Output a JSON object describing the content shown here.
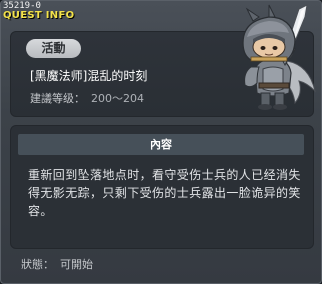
{
  "window": {
    "quest_id": "35219-0",
    "title": "QUEST INFO"
  },
  "quest": {
    "category_badge": "活動",
    "name": "[黑魔法师]混乱的时刻",
    "level_label": "建議等级：",
    "level_range": "200～204"
  },
  "content": {
    "header": "內容",
    "body": "重新回到坠落地点时，看守受伤士兵的人已经消失得无影无踪，只剩下受伤的士兵露出一脸诡异的笑容。"
  },
  "status": {
    "label": "狀態：",
    "value": "可開始"
  },
  "colors": {
    "title": "#f3e24a",
    "panel": "#2b3036",
    "header": "#465059",
    "badge": "#c8cbcf"
  }
}
